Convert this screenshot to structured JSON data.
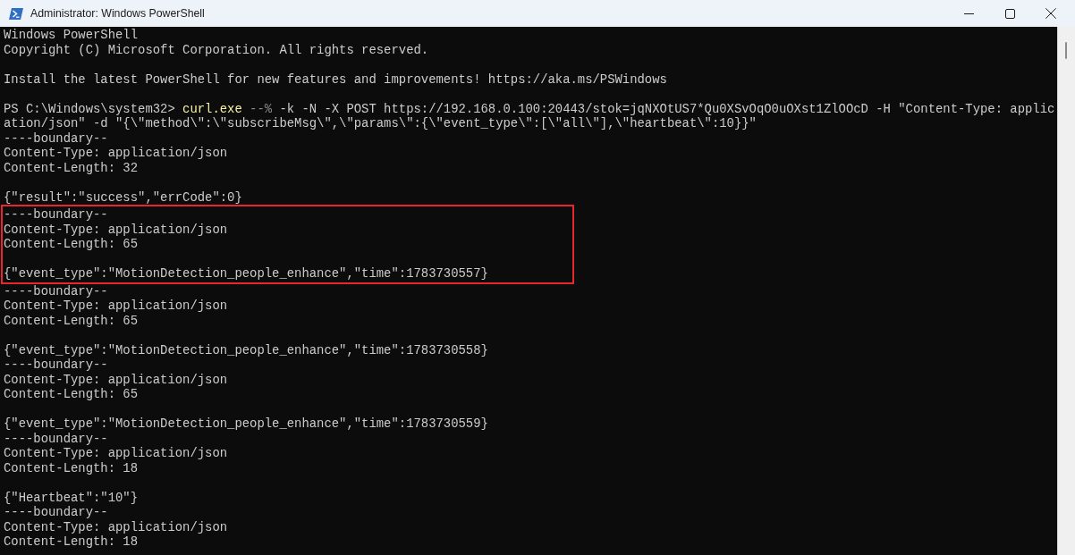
{
  "window": {
    "title": "Administrator: Windows PowerShell"
  },
  "console": {
    "lines": [
      {
        "kind": "output",
        "text": "Windows PowerShell",
        "highlighted": false
      },
      {
        "kind": "output",
        "text": "Copyright (C) Microsoft Corporation. All rights reserved.",
        "highlighted": false
      },
      {
        "kind": "blank",
        "highlighted": false
      },
      {
        "kind": "output",
        "text": "Install the latest PowerShell for new features and improvements! https://aka.ms/PSWindows",
        "highlighted": false
      },
      {
        "kind": "blank",
        "highlighted": false
      },
      {
        "kind": "command",
        "segments": [
          {
            "kind": "prompt",
            "text": "PS C:\\Windows\\system32>"
          },
          {
            "kind": "command",
            "text": "curl.exe"
          },
          {
            "kind": "operator",
            "text": "--%"
          },
          {
            "kind": "argument",
            "text": "-k -N -X POST https://192.168.0.100:20443/stok=jqNXOtUS7*Qu0XSvOqO0uOXst1ZlOOcD -H \"Content-Type: applic"
          }
        ],
        "highlighted": false
      },
      {
        "kind": "output",
        "text": "ation/json\" -d \"{\\\"method\\\":\\\"subscribeMsg\\\",\\\"params\\\":{\\\"event_type\\\":[\\\"all\\\"],\\\"heartbeat\\\":10}}\"",
        "highlighted": false
      },
      {
        "kind": "output",
        "text": "----boundary--",
        "highlighted": false
      },
      {
        "kind": "output",
        "text": "Content-Type: application/json",
        "highlighted": false
      },
      {
        "kind": "output",
        "text": "Content-Length: 32",
        "highlighted": false
      },
      {
        "kind": "blank",
        "highlighted": false
      },
      {
        "kind": "output",
        "text": "{\"result\":\"success\",\"errCode\":0}",
        "highlighted": false
      },
      {
        "kind": "output",
        "text": "----boundary--",
        "highlighted": true
      },
      {
        "kind": "output",
        "text": "Content-Type: application/json",
        "highlighted": true
      },
      {
        "kind": "output",
        "text": "Content-Length: 65",
        "highlighted": true
      },
      {
        "kind": "blank",
        "highlighted": true
      },
      {
        "kind": "output",
        "text": "{\"event_type\":\"MotionDetection_people_enhance\",\"time\":1783730557}",
        "highlighted": true
      },
      {
        "kind": "output",
        "text": "----boundary--",
        "highlighted": false
      },
      {
        "kind": "output",
        "text": "Content-Type: application/json",
        "highlighted": false
      },
      {
        "kind": "output",
        "text": "Content-Length: 65",
        "highlighted": false
      },
      {
        "kind": "blank",
        "highlighted": false
      },
      {
        "kind": "output",
        "text": "{\"event_type\":\"MotionDetection_people_enhance\",\"time\":1783730558}",
        "highlighted": false
      },
      {
        "kind": "output",
        "text": "----boundary--",
        "highlighted": false
      },
      {
        "kind": "output",
        "text": "Content-Type: application/json",
        "highlighted": false
      },
      {
        "kind": "output",
        "text": "Content-Length: 65",
        "highlighted": false
      },
      {
        "kind": "blank",
        "highlighted": false
      },
      {
        "kind": "output",
        "text": "{\"event_type\":\"MotionDetection_people_enhance\",\"time\":1783730559}",
        "highlighted": false
      },
      {
        "kind": "output",
        "text": "----boundary--",
        "highlighted": false
      },
      {
        "kind": "output",
        "text": "Content-Type: application/json",
        "highlighted": false
      },
      {
        "kind": "output",
        "text": "Content-Length: 18",
        "highlighted": false
      },
      {
        "kind": "blank",
        "highlighted": false
      },
      {
        "kind": "output",
        "text": "{\"Heartbeat\":\"10\"}",
        "highlighted": false
      },
      {
        "kind": "output",
        "text": "----boundary--",
        "highlighted": false
      },
      {
        "kind": "output",
        "text": "Content-Type: application/json",
        "highlighted": false
      },
      {
        "kind": "output",
        "text": "Content-Length: 18",
        "highlighted": false
      }
    ]
  }
}
